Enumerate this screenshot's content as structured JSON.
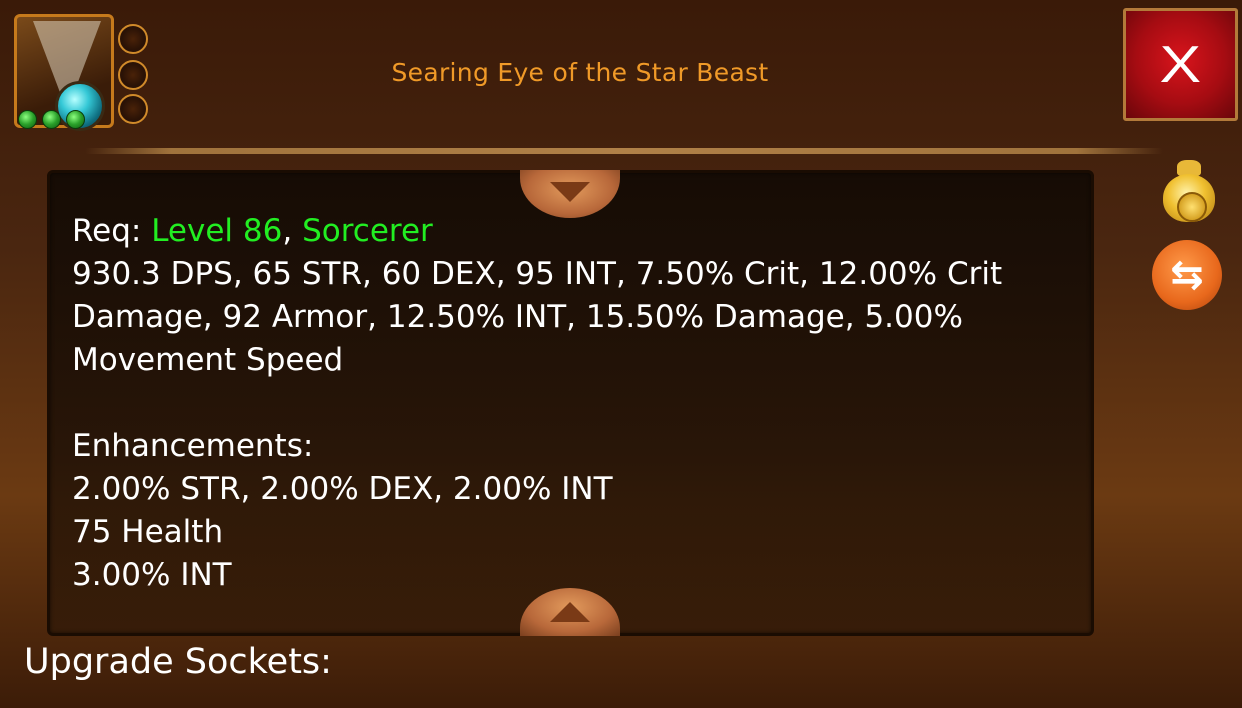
{
  "item": {
    "name": "Searing Eye of the Star Beast",
    "icon": "gem-amulet-icon",
    "socket_count": 3,
    "gem_count": 3
  },
  "close_button": {
    "label": "X"
  },
  "description": {
    "req_label": "Req: ",
    "req_level": "Level 86",
    "req_sep": ", ",
    "req_class": "Sorcerer",
    "stats_lines": [
      "930.3 DPS, 65 STR, 60 DEX, 95 INT, 7.50% Crit, 12.00% Crit",
      "Damage, 92 Armor, 12.50% INT, 15.50% Damage, 5.00%",
      "Movement Speed"
    ],
    "enhancements_label": "Enhancements:",
    "enhancement_lines": [
      "2.00% STR, 2.00% DEX, 2.00% INT",
      "75 Health",
      "3.00% INT"
    ]
  },
  "side_buttons": {
    "sell_icon": "money-bag-icon",
    "swap_icon": "swap-arrows-icon"
  },
  "upgrade_sockets_label": "Upgrade Sockets:",
  "colors": {
    "title": "#f09a28",
    "requirement": "#22ee22",
    "close_bg": "#c0101a"
  }
}
